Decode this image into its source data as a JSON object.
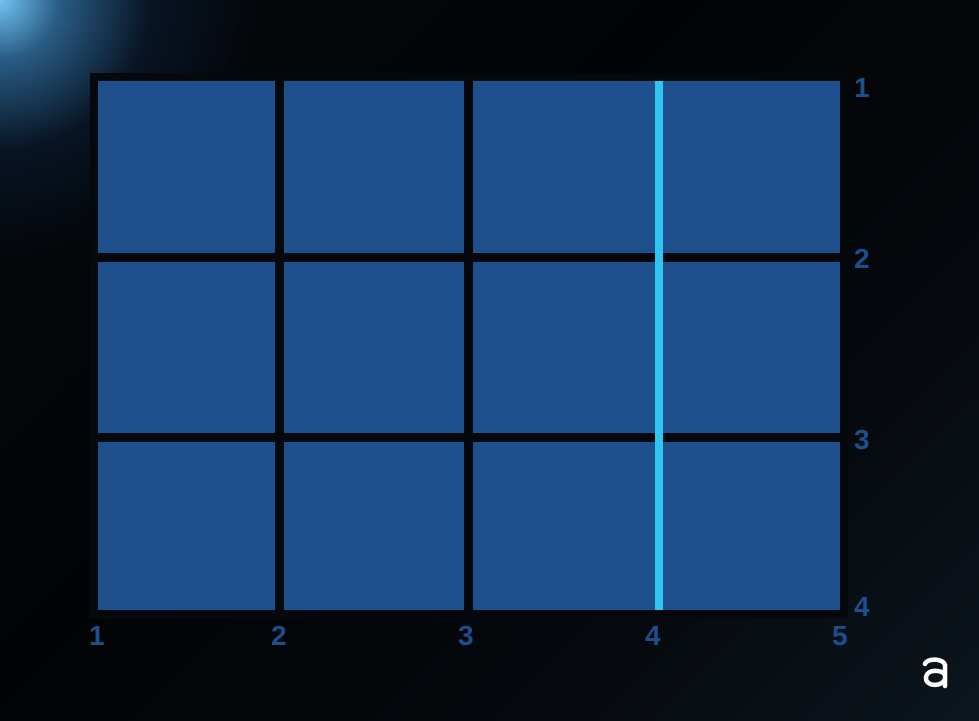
{
  "grid": {
    "rows": 3,
    "columns": 4,
    "cell_color": "#1e508d",
    "gap_color": "#05080d",
    "highlighted_column_line": 4,
    "highlight_color": "#2ec6f0"
  },
  "column_line_labels": [
    "1",
    "2",
    "3",
    "4",
    "5"
  ],
  "row_line_labels": [
    "1",
    "2",
    "3",
    "4"
  ],
  "label_color": "#1c4f8c",
  "logo": {
    "icon": "letter-a-logo-icon",
    "text": "a"
  }
}
